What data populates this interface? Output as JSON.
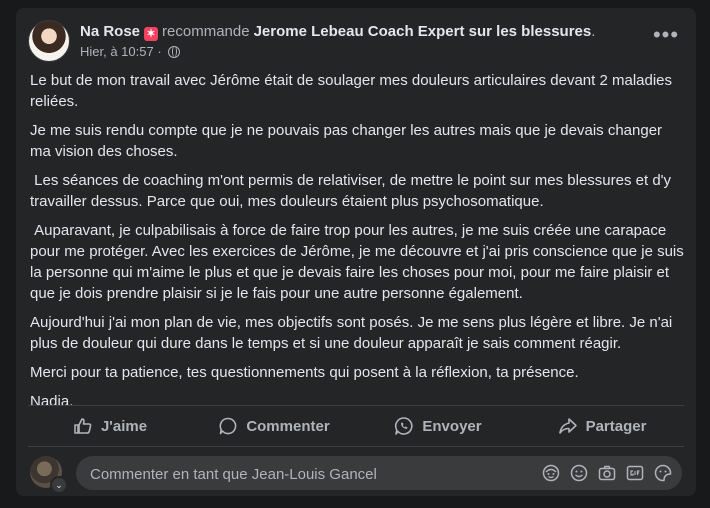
{
  "post": {
    "author": "Na Rose",
    "badge_glyph": "✶",
    "verb": "recommande",
    "page_name": "Jerome Lebeau Coach Expert sur les blessures",
    "dot": ".",
    "timestamp": "Hier, à 10:57",
    "separator": "·",
    "more_glyph": "•••",
    "paragraphs": [
      "Le but de mon travail avec Jérôme était de soulager mes douleurs articulaires devant 2 maladies reliées.",
      "Je me suis rendu compte que je ne pouvais pas changer les autres mais que je devais changer ma vision des choses.",
      " Les séances de coaching m'ont permis de relativiser, de mettre le point sur mes blessures et d'y travailler dessus. Parce que oui, mes douleurs étaient plus psychosomatique.",
      " Auparavant, je culpabilisais à force de faire trop pour les autres, je me suis créée une carapace pour me protéger. Avec les exercices de Jérôme, je me découvre et j'ai pris conscience que je suis la personne qui m'aime le plus et que je devais faire les choses pour moi, pour me faire plaisir et que je dois prendre plaisir si je le fais pour une autre personne également.",
      "Aujourd'hui j'ai mon plan de vie, mes objectifs sont posés. Je me sens plus légère et libre. Je n'ai plus de douleur qui dure dans le temps et si une douleur apparaît je sais comment réagir.",
      "Merci pour ta patience, tes questionnements qui posent à la réflexion, ta présence.",
      "Nadia."
    ]
  },
  "actions": {
    "like": "J'aime",
    "comment": "Commenter",
    "send": "Envoyer",
    "share": "Partager"
  },
  "comment_box": {
    "placeholder": "Commenter en tant que Jean-Louis Gancel",
    "chevron_glyph": "⌄"
  },
  "icons": {
    "like": "thumbs-up-icon",
    "comment": "speech-bubble-icon",
    "send": "whatsapp-icon",
    "share": "share-arrow-icon",
    "avatar_sticker": "avatar-sticker-icon",
    "emoji": "emoji-icon",
    "camera": "camera-icon",
    "gif": "gif-icon",
    "sticker": "sticker-icon"
  },
  "colors": {
    "background": "#18191a",
    "card": "#242526",
    "text_primary": "#e4e6eb",
    "text_secondary": "#b0b3b8",
    "badge": "#f3425f"
  }
}
